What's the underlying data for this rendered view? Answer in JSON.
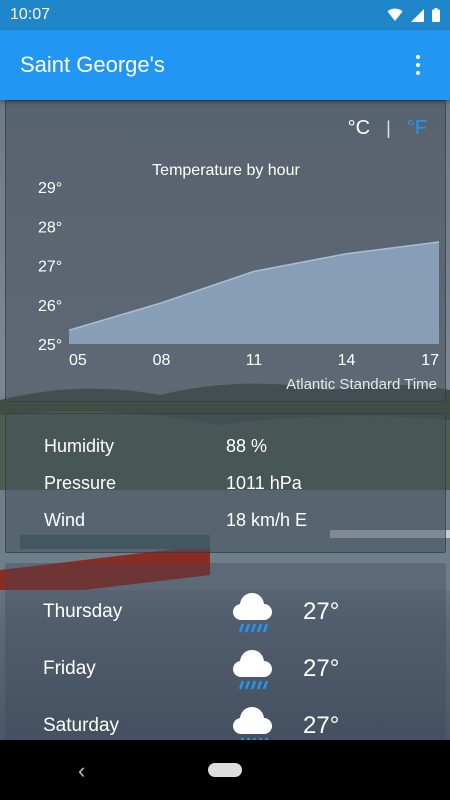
{
  "status_bar": {
    "time": "10:07",
    "icons": [
      "wifi-icon",
      "cell-signal-icon",
      "battery-icon"
    ]
  },
  "app_bar": {
    "title": "Saint George's",
    "menu_icon": "more-vert-icon"
  },
  "units": {
    "celsius": "°C",
    "separator": "|",
    "fahrenheit": "°F",
    "active": "°F"
  },
  "chart_data": {
    "type": "area",
    "title": "Temperature by hour",
    "x": [
      "05",
      "08",
      "11",
      "14",
      "17"
    ],
    "y_ticks": [
      "29°",
      "28°",
      "27°",
      "26°",
      "25°"
    ],
    "ylim": [
      25,
      29
    ],
    "series": [
      {
        "values": [
          25.35,
          26.05,
          26.85,
          27.3,
          27.6
        ]
      }
    ],
    "footnote": "Atlantic Standard Time",
    "fill_color": "#8fa9c2"
  },
  "details": [
    {
      "label": "Humidity",
      "value": "88 %"
    },
    {
      "label": "Pressure",
      "value": "1011 hPa"
    },
    {
      "label": "Wind",
      "value": "18 km/h E"
    }
  ],
  "forecast": [
    {
      "day": "Thursday",
      "icon": "rain-cloud-icon",
      "temp": "27°"
    },
    {
      "day": "Friday",
      "icon": "rain-cloud-icon",
      "temp": "27°"
    },
    {
      "day": "Saturday",
      "icon": "rain-cloud-icon",
      "temp": "27°"
    }
  ],
  "colors": {
    "status_bar": "#1f86c9",
    "app_bar": "#2196f3",
    "accent": "#2196f3"
  }
}
